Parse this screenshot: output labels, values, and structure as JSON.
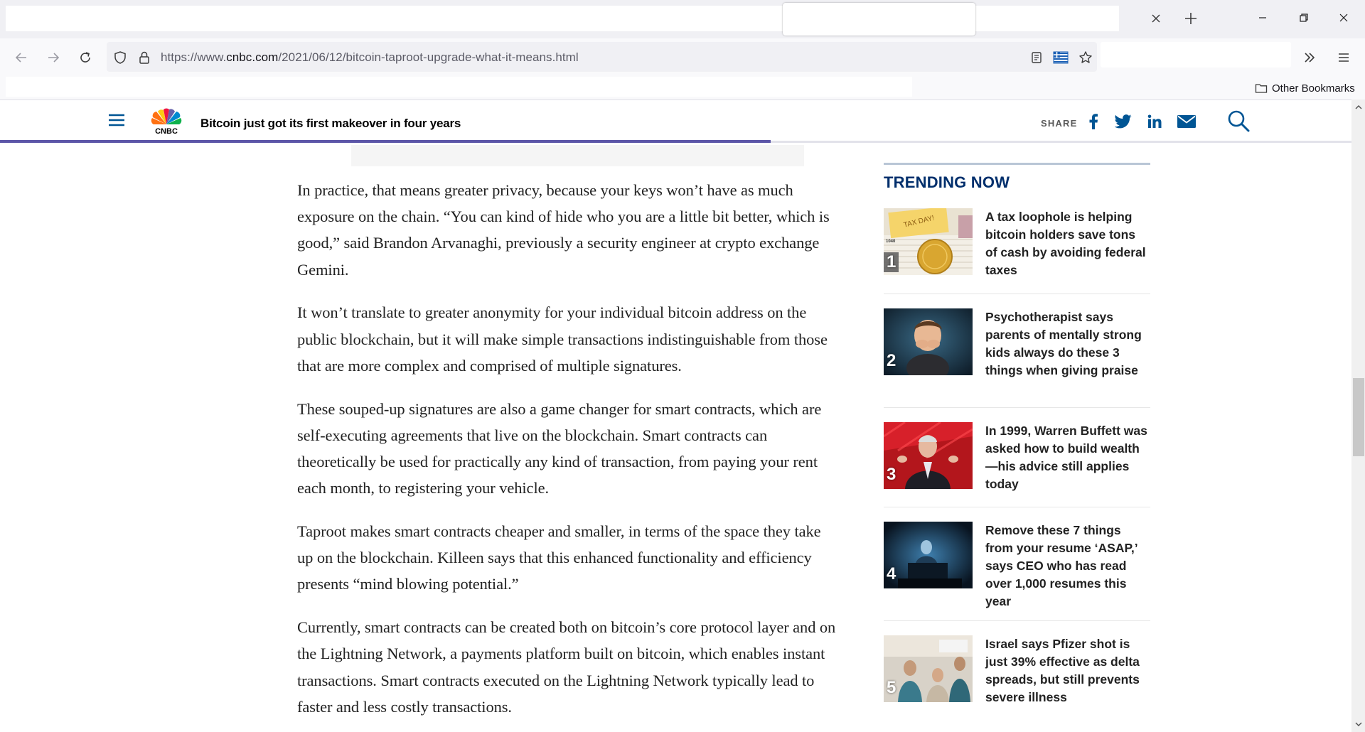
{
  "browser": {
    "url_prefix": "https://www.",
    "url_host": "cnbc.com",
    "url_path": "/2021/06/12/bitcoin-taproot-upgrade-what-it-means.html",
    "other_bookmarks": "Other Bookmarks"
  },
  "header": {
    "headline": "Bitcoin just got its first makeover in four years",
    "share_label": "SHARE",
    "progress": 0.57,
    "logo_text": "CNBC"
  },
  "article": {
    "paragraphs": [
      "In practice, that means greater privacy, because your keys won’t have as much exposure on the chain. “You can kind of hide who you are a little bit better, which is good,” said Brandon Arvanaghi, previously a security engineer at crypto exchange Gemini.",
      "It won’t translate to greater anonymity for your individual bitcoin address on the public blockchain, but it will make simple transactions indistinguishable from those that are more complex and comprised of multiple signatures.",
      "These souped-up signatures are also a game changer for smart contracts, which are self-executing agreements that live on the blockchain. Smart contracts can theoretically be used for practically any kind of transaction, from paying your rent each month, to registering your vehicle.",
      "Taproot makes smart contracts cheaper and smaller, in terms of the space they take up on the blockchain. Killeen says that this enhanced functionality and efficiency presents “mind blowing potential.”",
      "Currently, smart contracts can be created both on bitcoin’s core protocol layer and on the Lightning Network, a payments platform built on bitcoin, which enables instant transactions. Smart contracts executed on the Lightning Network typically lead to faster and less costly transactions."
    ]
  },
  "trending": {
    "title": "TRENDING NOW",
    "items": [
      {
        "rank": "1",
        "title": "A tax loophole is helping bitcoin holders save tons of cash by avoiding federal taxes"
      },
      {
        "rank": "2",
        "title": "Psychotherapist says parents of mentally strong kids always do these 3 things when giving praise"
      },
      {
        "rank": "3",
        "title": "In 1999, Warren Buffett was asked how to build wealth—his advice still applies today"
      },
      {
        "rank": "4",
        "title": "Remove these 7 things from your resume ‘ASAP,’ says CEO who has read over 1,000 resumes this year"
      },
      {
        "rank": "5",
        "title": "Israel says Pfizer shot is just 39% effective as delta spreads, but still prevents severe illness"
      }
    ]
  },
  "thumb_labels": {
    "tax_note": "TAX DAY!",
    "form": "1040"
  }
}
